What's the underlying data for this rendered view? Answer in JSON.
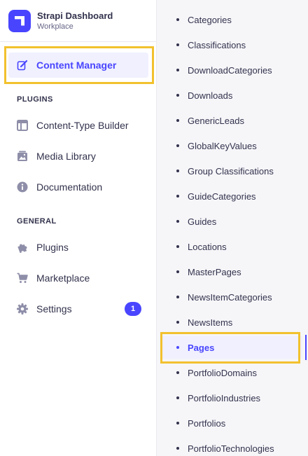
{
  "brand": {
    "title": "Strapi Dashboard",
    "subtitle": "Workplace",
    "logo_icon": "strapi-logo-icon"
  },
  "nav": {
    "content_manager": {
      "label": "Content Manager",
      "icon": "pen-icon"
    },
    "plugins_title": "PLUGINS",
    "plugins": [
      {
        "label": "Content-Type Builder",
        "icon": "layout-icon"
      },
      {
        "label": "Media Library",
        "icon": "image-icon"
      },
      {
        "label": "Documentation",
        "icon": "info-icon"
      }
    ],
    "general_title": "GENERAL",
    "general": [
      {
        "label": "Plugins",
        "icon": "puzzle-icon"
      },
      {
        "label": "Marketplace",
        "icon": "cart-icon"
      },
      {
        "label": "Settings",
        "icon": "gear-icon",
        "badge": "1"
      }
    ]
  },
  "collections": {
    "items": [
      "Categories",
      "Classifications",
      "DownloadCategories",
      "Downloads",
      "GenericLeads",
      "GlobalKeyValues",
      "Group Classifications",
      "GuideCategories",
      "Guides",
      "Locations",
      "MasterPages",
      "NewsItemCategories",
      "NewsItems",
      "Pages",
      "PortfolioDomains",
      "PortfolioIndustries",
      "Portfolios",
      "PortfolioTechnologies"
    ],
    "active": "Pages"
  },
  "colors": {
    "accent": "#4945ff",
    "highlight": "#f2c12e",
    "panel_bg": "#f6f6f9"
  }
}
